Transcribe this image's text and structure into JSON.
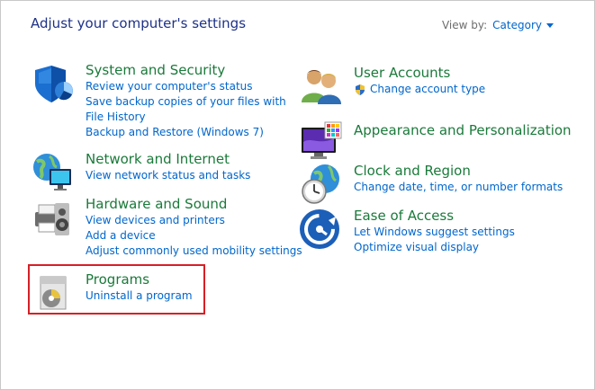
{
  "page_title": "Adjust your computer's settings",
  "view_by": {
    "label": "View by:",
    "value": "Category"
  },
  "left": [
    {
      "id": "system-security",
      "heading": "System and Security",
      "links": [
        "Review your computer's status",
        "Save backup copies of your files with File History",
        "Backup and Restore (Windows 7)"
      ]
    },
    {
      "id": "network-internet",
      "heading": "Network and Internet",
      "links": [
        "View network status and tasks"
      ]
    },
    {
      "id": "hardware-sound",
      "heading": "Hardware and Sound",
      "links": [
        "View devices and printers",
        "Add a device",
        "Adjust commonly used mobility settings"
      ]
    },
    {
      "id": "programs",
      "heading": "Programs",
      "links": [
        "Uninstall a program"
      ]
    }
  ],
  "right": [
    {
      "id": "user-accounts",
      "heading": "User Accounts",
      "links": [
        "Change account type"
      ]
    },
    {
      "id": "appearance",
      "heading": "Appearance and Personalization",
      "links": []
    },
    {
      "id": "clock-region",
      "heading": "Clock and Region",
      "links": [
        "Change date, time, or number formats"
      ]
    },
    {
      "id": "ease-access",
      "heading": "Ease of Access",
      "links": [
        "Let Windows suggest settings",
        "Optimize visual display"
      ]
    }
  ],
  "colors": {
    "title": "#1e3287",
    "heading": "#1a7a3a",
    "link": "#0066cc",
    "highlight": "#d71f26"
  }
}
